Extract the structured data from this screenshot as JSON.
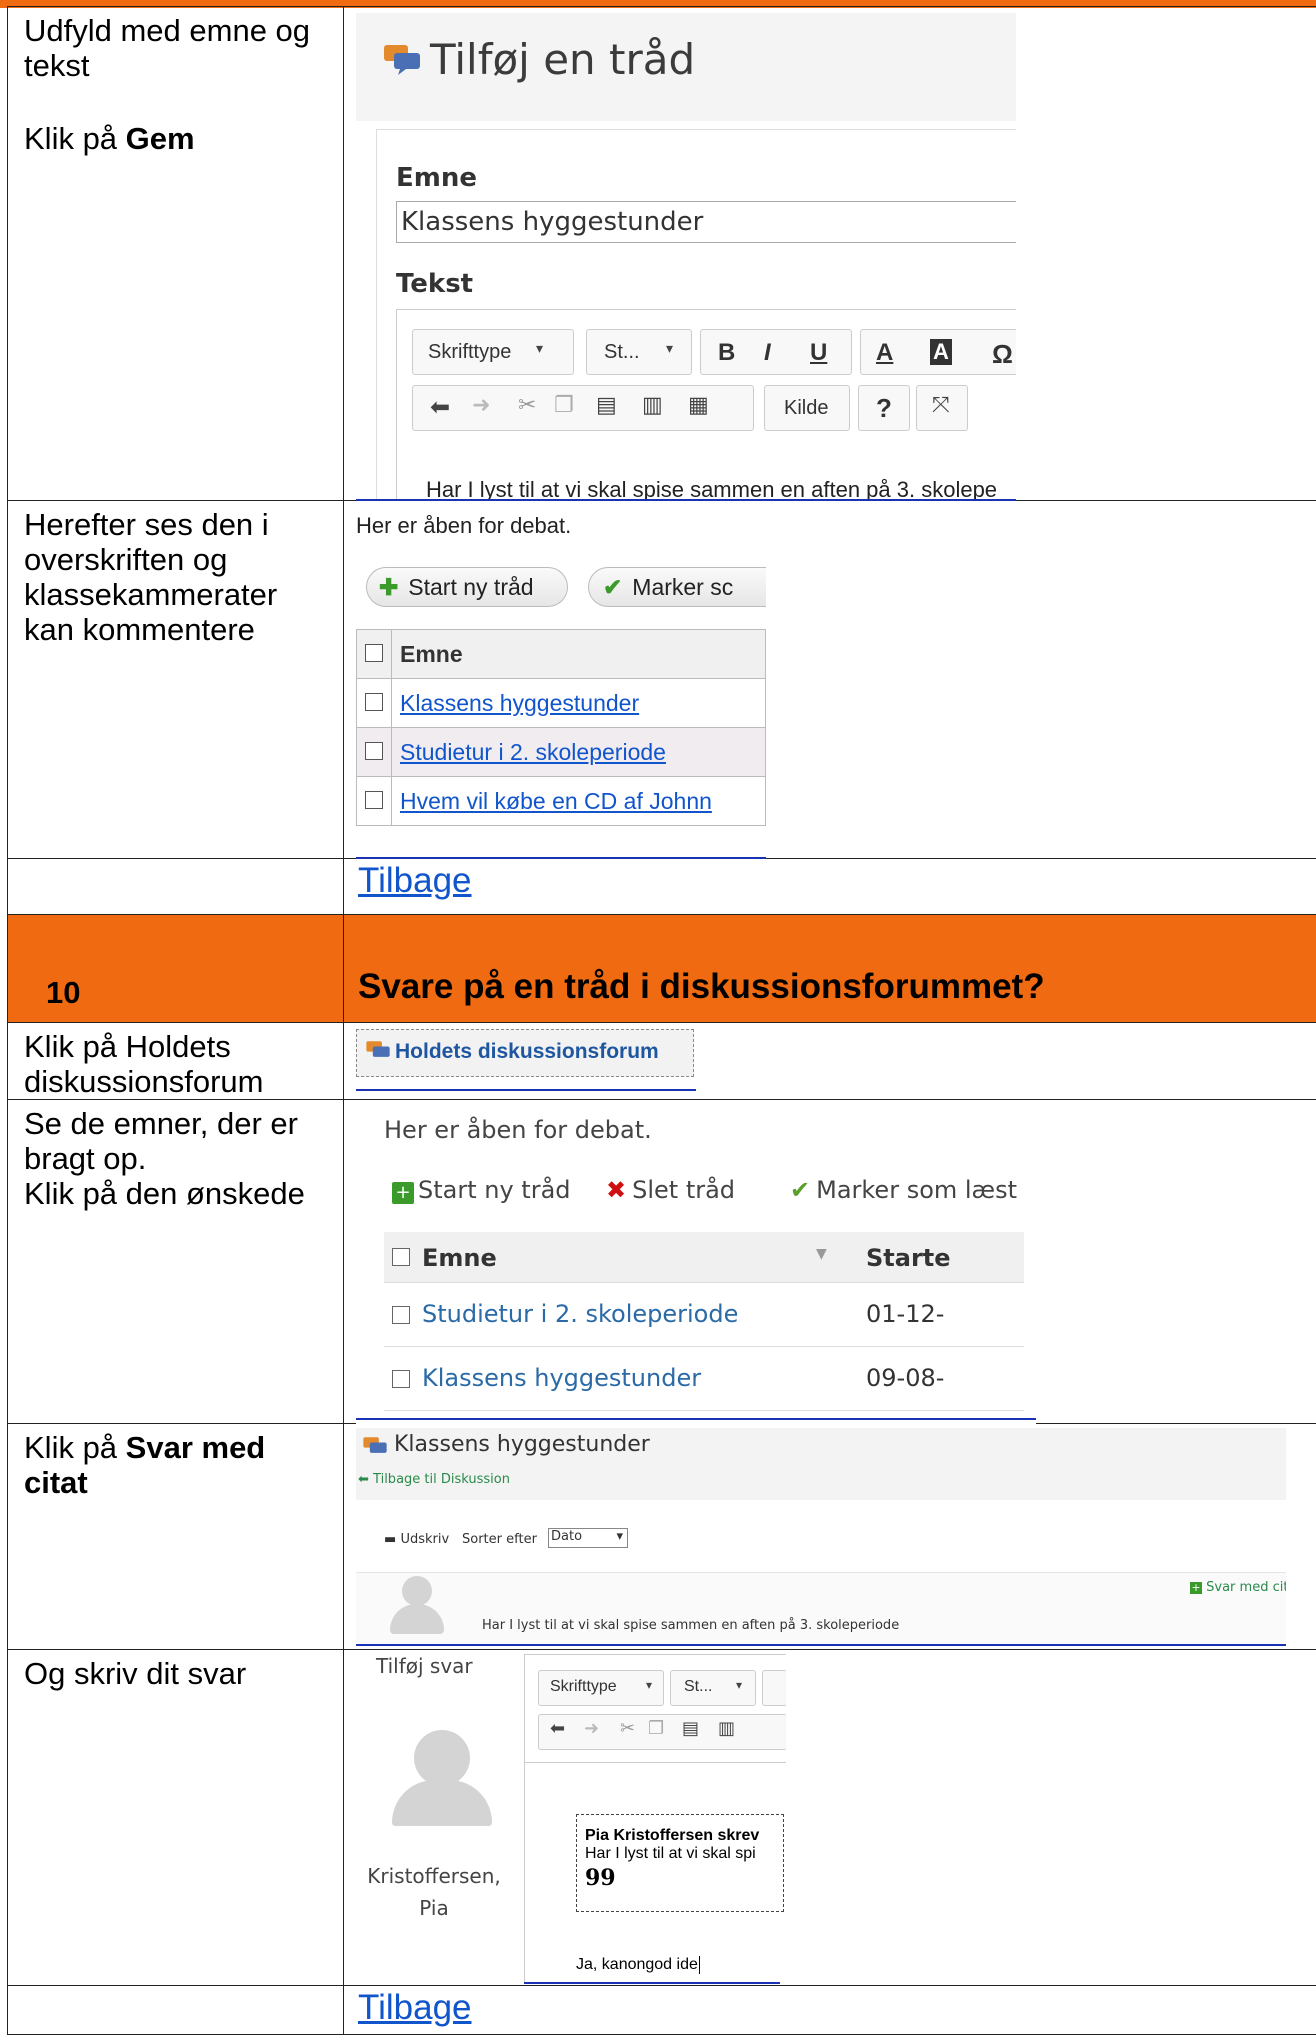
{
  "rows": {
    "r1": {
      "text1": "Udfyld med emne og tekst",
      "text2_prefix": "Klik på ",
      "text2_bold": "Gem",
      "shot": {
        "title": "Tilføj en tråd",
        "label_subject": "Emne",
        "subject_value": "Klassens hyggestunder",
        "label_text": "Tekst",
        "toolbar": {
          "font": "Skrifttype",
          "size": "St...",
          "bold": "B",
          "italic": "I",
          "underline": "U",
          "textcolor": "A",
          "bgcolor": "A",
          "special": "Ω",
          "source": "Kilde",
          "help": "?"
        },
        "editor_text": "Har I lyst til at vi skal spise sammen en aften på 3. skolepe"
      }
    },
    "r2": {
      "text": "Herefter ses den i overskriften og klassekammerater kan kommentere",
      "shot": {
        "intro": "Her er åben for debat.",
        "btn_new": "Start ny tråd",
        "btn_mark": "Marker sc",
        "col_subject": "Emne",
        "threads": [
          "Klassens hyggestunder",
          "Studietur i 2. skoleperiode",
          "Hvem vil købe en CD af Johnn"
        ]
      }
    },
    "r3": {
      "link": "Tilbage"
    },
    "section": {
      "number": "10",
      "title": "Svare på en tråd i diskussionsforummet?"
    },
    "r4": {
      "text": "Klik på Holdets diskussionsforum",
      "shot": {
        "button": "Holdets diskussionsforum"
      }
    },
    "r5": {
      "text1": "Se de emner, der er bragt op.",
      "text2": "Klik på den ønskede",
      "shot": {
        "intro": "Her er åben for debat.",
        "act_new": "Start ny tråd",
        "act_delete": "Slet tråd",
        "act_mark": "Marker som læst",
        "col_subject": "Emne",
        "col_started": "Starte",
        "sort_glyph": "▼",
        "rows": [
          {
            "subject": "Studietur i 2. skoleperiode",
            "date": "01-12-"
          },
          {
            "subject": "Klassens hyggestunder",
            "date": "09-08-"
          }
        ]
      }
    },
    "r6": {
      "text_prefix": "Klik på ",
      "text_bold": "Svar med citat",
      "shot": {
        "title": "Klassens hyggestunder",
        "back": "Tilbage til Diskussion",
        "print": "Udskriv",
        "sort_label": "Sorter efter",
        "sort_value": "Dato",
        "reply_quote": "Svar med citat",
        "post_text": "Har I lyst til at vi skal spise sammen en aften på 3. skoleperiode"
      }
    },
    "r7": {
      "text": "Og skriv dit svar",
      "shot": {
        "heading": "Tilføj svar",
        "user_line1": "Kristoffersen,",
        "user_line2": "Pia",
        "font": "Skrifttype",
        "size": "St...",
        "quote_author": "Pia Kristoffersen skrev",
        "quote_text": "Har I lyst til at vi skal spi",
        "quote_mark": "99",
        "reply_text": "Ja, kanongod ide"
      }
    },
    "r8": {
      "link": "Tilbage"
    }
  },
  "colors": {
    "accent_orange": "#ef6a10",
    "link_blue": "#1155cc",
    "underline_blue": "#1a33b5"
  }
}
